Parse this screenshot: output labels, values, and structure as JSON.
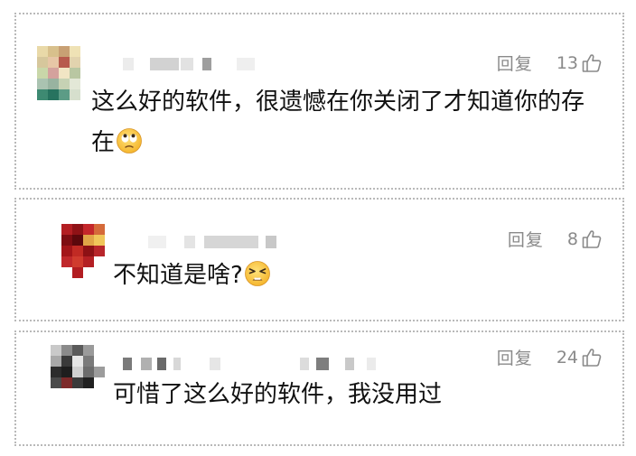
{
  "comments": [
    {
      "text": "这么好的软件，很遗憾在你关闭了才知道你的存在",
      "reply_label": "回复",
      "like_count": "13",
      "emoji_icon": "face-with-rolling-eyes-emoji"
    },
    {
      "text": "不知道是啥?",
      "reply_label": "回复",
      "like_count": "8",
      "emoji_icon": "tired-face-emoji"
    },
    {
      "text": "可惜了这么好的软件，我没用过",
      "reply_label": "回复",
      "like_count": "24",
      "emoji_icon": ""
    }
  ],
  "colors": {
    "border": "#b9b9b9",
    "meta_text": "#8a8a8a",
    "body_text": "#111111"
  }
}
